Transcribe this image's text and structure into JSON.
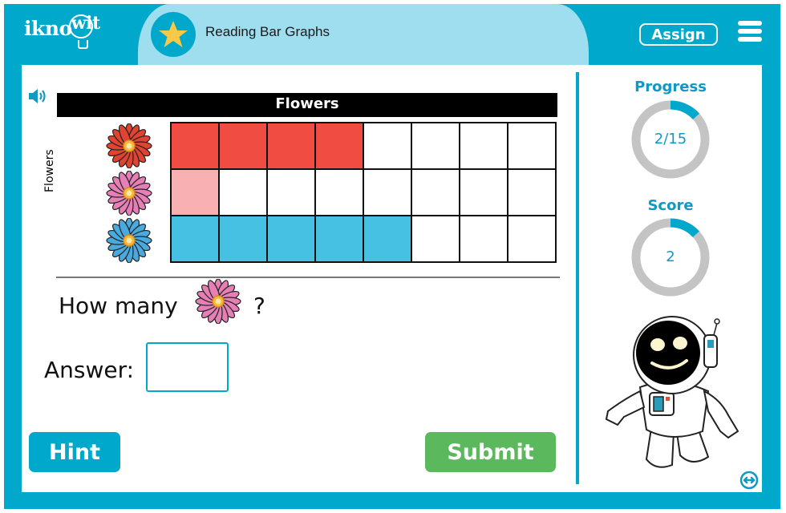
{
  "header": {
    "logo_text": "iknowit",
    "lesson_title": "Reading Bar Graphs",
    "assign_label": "Assign",
    "icons": {
      "lesson": "star-icon",
      "menu": "hamburger-menu-icon"
    }
  },
  "colors": {
    "brand": "#00a8cc",
    "header_pill": "#9fdeee",
    "star": "#f7c948",
    "submit": "#5cb85c",
    "ring_track": "#c4c4c4",
    "ring_fill": "#00a8cc"
  },
  "question": {
    "audio_icon": "speaker-icon",
    "prompt_prefix": "How many",
    "prompt_subject": "pink flower",
    "prompt_suffix": "?",
    "answer_label": "Answer:",
    "answer_value": "",
    "hint_label": "Hint",
    "submit_label": "Submit"
  },
  "chart_data": {
    "type": "bar",
    "orientation": "horizontal-pictograph",
    "title": "Flowers",
    "ylabel": "Flowers",
    "xlabel": "",
    "grid_columns": 8,
    "categories": [
      "red flower",
      "pink flower",
      "blue flower"
    ],
    "values": [
      4,
      1,
      5
    ],
    "colors": [
      "#f04c42",
      "#f8b0b3",
      "#47c1e3"
    ],
    "xlim": [
      0,
      8
    ]
  },
  "sidebar": {
    "progress": {
      "label": "Progress",
      "text": "2/15",
      "current": 2,
      "total": 15
    },
    "score": {
      "label": "Score",
      "text": "2",
      "fraction": 0.133
    },
    "mascot": "astronaut-mascot",
    "swap_icon": "swap-horizontal-icon"
  }
}
